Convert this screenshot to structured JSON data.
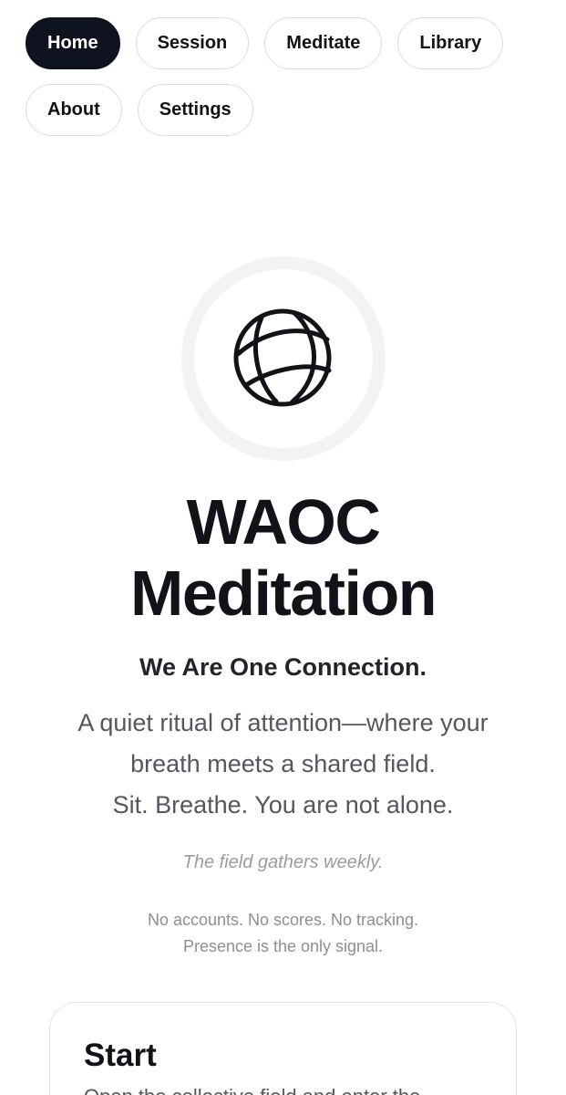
{
  "nav": {
    "items": [
      {
        "label": "Home",
        "active": true
      },
      {
        "label": "Session"
      },
      {
        "label": "Meditate"
      },
      {
        "label": "Library"
      },
      {
        "label": "About"
      },
      {
        "label": "Settings"
      }
    ]
  },
  "hero": {
    "logo_icon": "globe-icon",
    "title_line1": "WAOC",
    "title_line2": "Meditation",
    "tagline": "We Are One Connection.",
    "lede_line1": "A quiet ritual of attention—where your",
    "lede_line2": "breath meets a shared field.",
    "lede_line3": "Sit. Breathe. You are not alone.",
    "note": "The field gathers weekly.",
    "fine_line1": "No accounts. No scores. No tracking.",
    "fine_line2": "Presence is the only signal."
  },
  "start_card": {
    "title": "Start",
    "text": "Open the collective field and enter the"
  },
  "colors": {
    "active_pill": "#0f1320",
    "text_primary": "#111318",
    "text_muted": "#55575f"
  }
}
